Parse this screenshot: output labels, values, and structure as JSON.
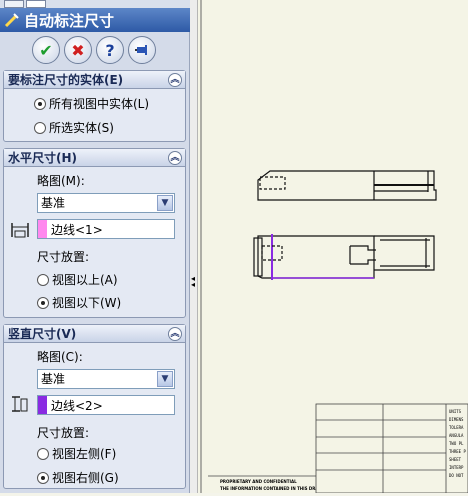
{
  "title": "自动标注尺寸",
  "colors": {
    "accent": "#3a64b0",
    "edge1": "#ff88ee",
    "edge2": "#8a2be2"
  },
  "actions": [
    {
      "name": "ok",
      "icon": "check-icon",
      "glyph": "✔",
      "color": "#1e9e2e"
    },
    {
      "name": "cancel",
      "icon": "cross-icon",
      "glyph": "✖",
      "color": "#d02020"
    },
    {
      "name": "help",
      "icon": "question-icon",
      "glyph": "?",
      "color": "#1a3f9a"
    },
    {
      "name": "pin",
      "icon": "pushpin-icon",
      "glyph": "⚲",
      "color": "#1a3f9a"
    }
  ],
  "entities": {
    "heading": "要标注尺寸的实体(E)",
    "options": [
      {
        "label": "所有视图中实体(L)",
        "selected": true
      },
      {
        "label": "所选实体(S)",
        "selected": false
      }
    ]
  },
  "horizontal": {
    "heading": "水平尺寸(H)",
    "scheme_label": "略图(M):",
    "scheme_value": "基准",
    "edge": "边线<1>",
    "placement_label": "尺寸放置:",
    "options": [
      {
        "label": "视图以上(A)",
        "selected": false
      },
      {
        "label": "视图以下(W)",
        "selected": true
      }
    ]
  },
  "vertical": {
    "heading": "竖直尺寸(V)",
    "scheme_label": "略图(C):",
    "scheme_value": "基准",
    "edge": "边线<2>",
    "placement_label": "尺寸放置:",
    "options": [
      {
        "label": "视图左侧(F)",
        "selected": false
      },
      {
        "label": "视图右侧(G)",
        "selected": true
      }
    ]
  },
  "titleblock": {
    "right_column": [
      "UNITS",
      "DIMENS",
      "TOLERA",
      "ANGULA",
      "TWO PL",
      "THREE P",
      "SHEET",
      "INTERP",
      "DO NOT"
    ],
    "footer_lines": [
      "PROPRIETARY AND CONFIDENTIAL",
      "THE INFORMATION CONTAINED IN THIS DRAWING IS"
    ]
  }
}
